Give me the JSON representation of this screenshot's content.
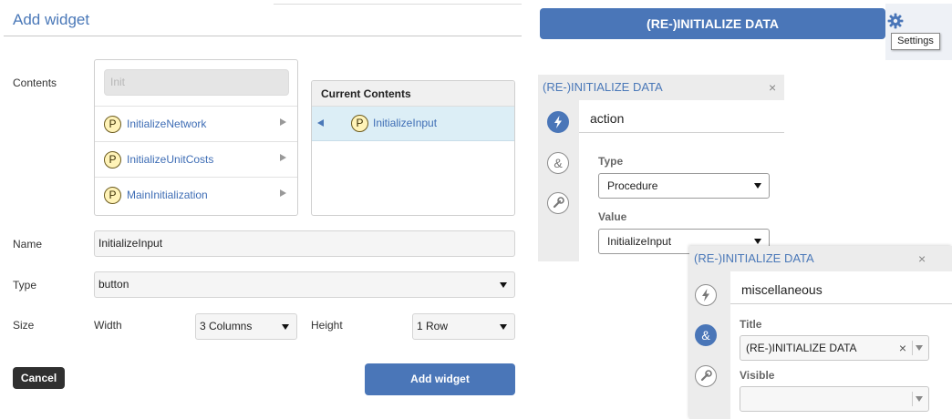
{
  "dialog": {
    "title": "Add widget",
    "contents_label": "Contents",
    "search_placeholder": "Init",
    "available_items": [
      {
        "badge": "P",
        "label": "InitializeNetwork"
      },
      {
        "badge": "P",
        "label": "InitializeUnitCosts"
      },
      {
        "badge": "P",
        "label": "MainInitialization"
      }
    ],
    "current_contents": {
      "header": "Current Contents",
      "items": [
        {
          "badge": "P",
          "label": "InitializeInput"
        }
      ]
    },
    "name_label": "Name",
    "name_value": "InitializeInput",
    "type_label": "Type",
    "type_value": "button",
    "size_label": "Size",
    "width_label": "Width",
    "width_value": "3 Columns",
    "height_label": "Height",
    "height_value": "1 Row",
    "cancel_label": "Cancel",
    "add_label": "Add widget"
  },
  "widget_button": {
    "label": "(RE-)INITIALIZE DATA",
    "settings_icon": "gear-icon",
    "tooltip": "Settings"
  },
  "action_panel": {
    "title": "(RE-)INITIALIZE DATA",
    "close": "×",
    "section": "action",
    "type_label": "Type",
    "type_value": "Procedure",
    "value_label": "Value",
    "value_value": "InitializeInput",
    "icons": [
      "lightning-icon",
      "ampersand-icon",
      "wrench-icon"
    ]
  },
  "misc_panel": {
    "title": "(RE-)INITIALIZE DATA",
    "close": "×",
    "section": "miscellaneous",
    "title_label": "Title",
    "title_value": "(RE-)INITIALIZE DATA",
    "clear": "×",
    "visible_label": "Visible",
    "visible_value": "",
    "icons": [
      "lightning-icon",
      "ampersand-icon",
      "wrench-icon"
    ]
  },
  "colors": {
    "accent": "#4a76b8",
    "highlight_row": "#dceef6",
    "cancel_bg": "#303030",
    "badge_fill": "#fff3b8"
  }
}
